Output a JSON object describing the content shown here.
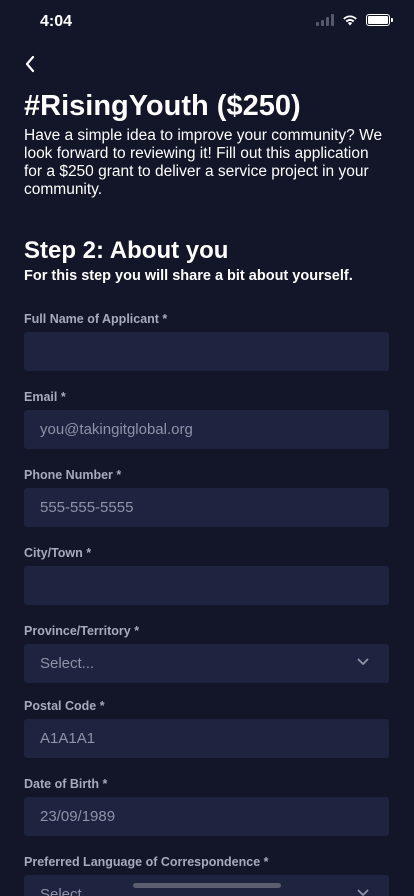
{
  "status": {
    "time": "4:04"
  },
  "header": {
    "title": "#RisingYouth ($250)",
    "intro": "Have a simple idea to improve your community? We look forward to reviewing it! Fill out this application for a $250 grant to deliver a service project in your community."
  },
  "step": {
    "title": "Step 2: About you",
    "subtitle": "For this step you will share a bit about yourself."
  },
  "form": {
    "full_name": {
      "label": "Full Name of Applicant *",
      "value": "",
      "placeholder": ""
    },
    "email": {
      "label": "Email *",
      "placeholder": "you@takingitglobal.org"
    },
    "phone": {
      "label": "Phone Number *",
      "placeholder": "555-555-5555"
    },
    "city": {
      "label": "City/Town *",
      "placeholder": ""
    },
    "province": {
      "label": "Province/Territory *",
      "selected": "Select..."
    },
    "postal": {
      "label": "Postal Code *",
      "placeholder": "A1A1A1"
    },
    "dob": {
      "label": "Date of Birth *",
      "placeholder": "23/09/1989"
    },
    "language": {
      "label": "Preferred Language of Correspondence *",
      "selected": "Select..."
    }
  },
  "colors": {
    "background": "#121628",
    "input_bg": "#1e2440",
    "label": "#a6aabb",
    "placeholder": "#8e93a8"
  }
}
